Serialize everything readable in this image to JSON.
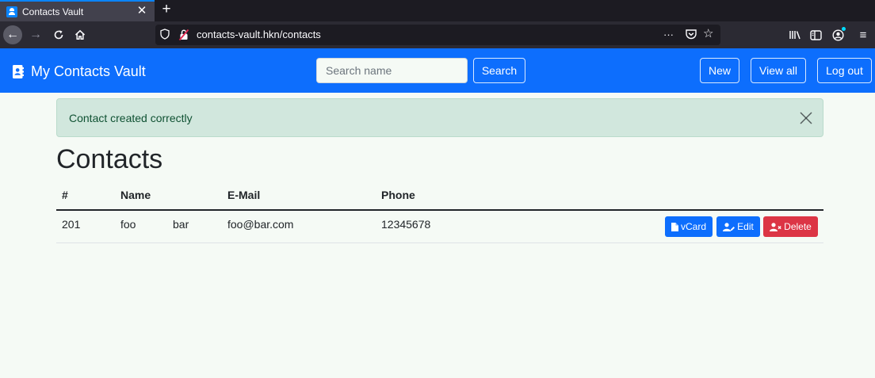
{
  "browser": {
    "tab_title": "Contacts Vault",
    "tab_close": "✕",
    "new_tab": "+",
    "url": "contacts-vault.hkn/contacts",
    "url_more": "···",
    "icons": {
      "back": "arrow-left-icon",
      "forward": "arrow-right-icon",
      "reload": "reload-icon",
      "home": "home-icon",
      "tracking": "shield-icon",
      "connection": "insecure-lock-icon",
      "pocket": "pocket-icon",
      "bookmark": "star-icon",
      "library": "library-icon",
      "sidebar": "sidebar-icon",
      "account": "account-icon",
      "menu": "hamburger-menu-icon"
    },
    "colors": {
      "tabbar": "#1c1b22",
      "toolbar": "#2b2a33",
      "active_tab": "#42414d",
      "accent": "#0a84ff"
    }
  },
  "navbar": {
    "brand": "My Contacts Vault",
    "brand_icon": "address-book-icon",
    "search_placeholder": "Search name",
    "search_value": "",
    "search_button": "Search",
    "new_button": "New",
    "view_all_button": "View all",
    "logout_button": "Log out",
    "color": "#0d6efd"
  },
  "alert": {
    "message": "Contact created correctly",
    "close_icon": "close-icon",
    "colors": {
      "background": "#d1e7dd",
      "text": "#0f5132"
    }
  },
  "page": {
    "title": "Contacts"
  },
  "table": {
    "columns": [
      "#",
      "Name",
      "E-Mail",
      "Phone"
    ],
    "rows": [
      {
        "id": "201",
        "first_name": "foo",
        "last_name": "bar",
        "email": "foo@bar.com",
        "phone": "12345678",
        "actions": {
          "vcard": "vCard",
          "edit": "Edit",
          "delete": "Delete",
          "vcard_icon": "file-icon",
          "edit_icon": "user-edit-icon",
          "delete_icon": "user-remove-icon"
        }
      }
    ]
  },
  "colors": {
    "primary": "#0d6efd",
    "danger": "#dc3545",
    "page_background": "#f5faf5"
  }
}
